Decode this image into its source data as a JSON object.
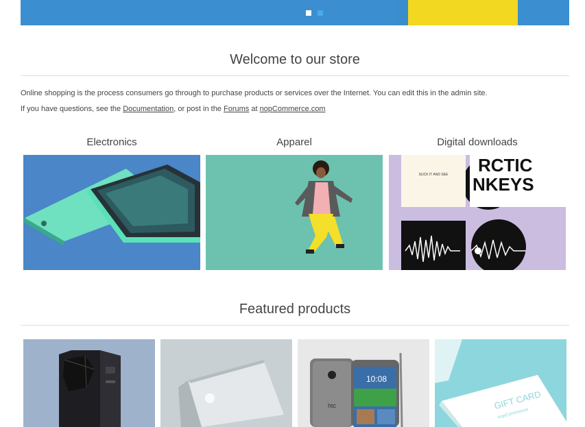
{
  "slider": {
    "dots": [
      "slide-1",
      "slide-2"
    ],
    "active": 0
  },
  "welcome": {
    "title": "Welcome to our store",
    "line1": "Online shopping is the process consumers go through to purchase products or services over the Internet. You can edit this in the admin site.",
    "line2_a": "If you have questions, see the ",
    "doc_link": "Documentation",
    "line2_b": ", or post in the ",
    "forums_link": "Forums",
    "line2_c": " at ",
    "site_link": "nopCommerce.com"
  },
  "categories": [
    {
      "name": "Electronics",
      "image": "phone-photo"
    },
    {
      "name": "Apparel",
      "image": "woman-jumping-photo"
    },
    {
      "name": "Digital downloads",
      "image": "album-covers-photo"
    }
  ],
  "featured": {
    "title": "Featured products",
    "products": [
      {
        "image": "server-photo"
      },
      {
        "image": "laptop-photo"
      },
      {
        "image": "htc-phone-photo"
      },
      {
        "image": "gift-card-photo"
      }
    ]
  },
  "album_art": {
    "cover1_text": "SUCK IT AND SEE",
    "cover2_text": "RCTIC\nNKEYS",
    "giftcard_text": "GIFT CARD",
    "giftcard_sub": "nopCommerce",
    "htc_logo": "htc",
    "htc_time": "10:08"
  },
  "colors": {
    "banner": "#3b8fd0",
    "banner_yellow": "#f2d820",
    "text": "#444444",
    "rule": "#dddddd"
  }
}
